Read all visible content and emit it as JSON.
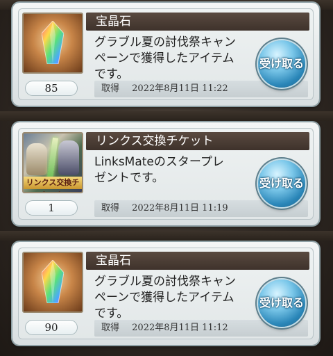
{
  "items": [
    {
      "title": "宝晶石",
      "description": "グラブル夏の討伐祭キャン\nペーンで獲得したアイテム\nです。",
      "quantity": "85",
      "received_label": "取得",
      "received_at": "2022年8月11日 11:22",
      "button_label": "受け取る",
      "icon": "crystal-icon"
    },
    {
      "title": "リンクス交換チケット",
      "description": "LinksMateのスタープレ\nゼントです。",
      "quantity": "1",
      "received_label": "取得",
      "received_at": "2022年8月11日 11:19",
      "button_label": "受け取る",
      "icon": "ticket-icon",
      "icon_banner": "リンクス交換チケット"
    },
    {
      "title": "宝晶石",
      "description": "グラブル夏の討伐祭キャン\nペーンで獲得したアイテム\nです。",
      "quantity": "90",
      "received_label": "取得",
      "received_at": "2022年8月11日 11:12",
      "button_label": "受け取る",
      "icon": "crystal-icon"
    }
  ],
  "colors": {
    "title_bar": "#3e322b",
    "button": "#2a86b8"
  }
}
